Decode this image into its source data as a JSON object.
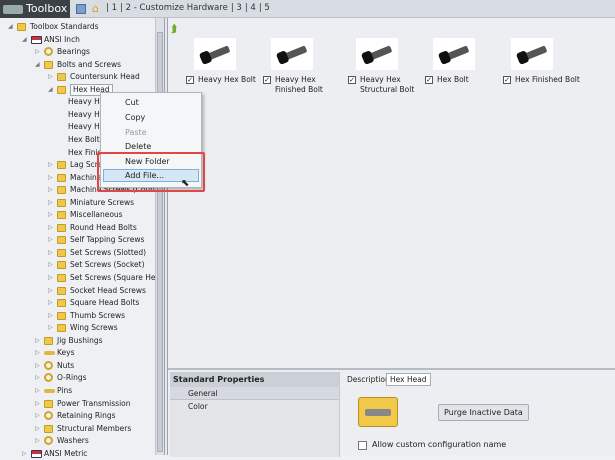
{
  "titlebar": {
    "title": "Toolbox",
    "breadcrumbs": [
      "1",
      "2 - Customize Hardware",
      "3",
      "4",
      "5"
    ]
  },
  "tree": [
    {
      "label": "Toolbox Standards",
      "level": 0,
      "icon": "folder-icon",
      "expanded": true
    },
    {
      "label": "ANSI Inch",
      "level": 1,
      "icon": "flag-icon",
      "expanded": true
    },
    {
      "label": "Bearings",
      "level": 2,
      "icon": "bearing-icon",
      "expanded": false
    },
    {
      "label": "Bolts and Screws",
      "level": 2,
      "icon": "folder-icon",
      "expanded": true
    },
    {
      "label": "Countersunk Head",
      "level": 3,
      "icon": "folder-icon",
      "expanded": false
    },
    {
      "label": "Hex Head",
      "level": 3,
      "icon": "folder-icon",
      "expanded": true,
      "selected": true
    },
    {
      "label": "Heavy He",
      "level": 4
    },
    {
      "label": "Heavy He",
      "level": 4
    },
    {
      "label": "Heavy He",
      "level": 4
    },
    {
      "label": "Hex Bolt",
      "level": 4
    },
    {
      "label": "Hex Finish",
      "level": 4
    },
    {
      "label": "Lag Screws",
      "level": 3,
      "icon": "folder-icon",
      "expanded": false
    },
    {
      "label": "Machine",
      "level": 3,
      "icon": "folder-icon",
      "expanded": false
    },
    {
      "label": "Machine Screws (Countersunk)",
      "level": 3,
      "icon": "folder-icon",
      "expanded": false
    },
    {
      "label": "Miniature Screws",
      "level": 3,
      "icon": "folder-icon",
      "expanded": false
    },
    {
      "label": "Miscellaneous",
      "level": 3,
      "icon": "folder-icon",
      "expanded": false
    },
    {
      "label": "Round Head Bolts",
      "level": 3,
      "icon": "folder-icon",
      "expanded": false
    },
    {
      "label": "Self Tapping Screws",
      "level": 3,
      "icon": "folder-icon",
      "expanded": false
    },
    {
      "label": "Set Screws (Slotted)",
      "level": 3,
      "icon": "folder-icon",
      "expanded": false
    },
    {
      "label": "Set Screws (Socket)",
      "level": 3,
      "icon": "folder-icon",
      "expanded": false
    },
    {
      "label": "Set Screws (Square Head",
      "level": 3,
      "icon": "folder-icon",
      "expanded": false
    },
    {
      "label": "Socket Head Screws",
      "level": 3,
      "icon": "folder-icon",
      "expanded": false
    },
    {
      "label": "Square Head Bolts",
      "level": 3,
      "icon": "folder-icon",
      "expanded": false
    },
    {
      "label": "Thumb Screws",
      "level": 3,
      "icon": "folder-icon",
      "expanded": false
    },
    {
      "label": "Wing Screws",
      "level": 3,
      "icon": "folder-icon",
      "expanded": false
    },
    {
      "label": "Jig Bushings",
      "level": 2,
      "icon": "bushing-icon",
      "expanded": false
    },
    {
      "label": "Keys",
      "level": 2,
      "icon": "key-icon",
      "expanded": false
    },
    {
      "label": "Nuts",
      "level": 2,
      "icon": "nut-icon",
      "expanded": false
    },
    {
      "label": "O-Rings",
      "level": 2,
      "icon": "oring-icon",
      "expanded": false
    },
    {
      "label": "Pins",
      "level": 2,
      "icon": "pin-icon",
      "expanded": false
    },
    {
      "label": "Power Transmission",
      "level": 2,
      "icon": "gear-icon",
      "expanded": false
    },
    {
      "label": "Retaining Rings",
      "level": 2,
      "icon": "retaining-ring-icon",
      "expanded": false
    },
    {
      "label": "Structural Members",
      "level": 2,
      "icon": "beam-icon",
      "expanded": false
    },
    {
      "label": "Washers",
      "level": 2,
      "icon": "washer-icon",
      "expanded": false
    },
    {
      "label": "ANSI Metric",
      "level": 1,
      "icon": "flag-icon",
      "expanded": false
    }
  ],
  "context_menu": {
    "items": [
      {
        "label": "Cut"
      },
      {
        "label": "Copy"
      },
      {
        "label": "Paste",
        "disabled": true
      },
      {
        "label": "Delete"
      },
      {
        "label": "New Folder"
      },
      {
        "label": "Add File...",
        "highlighted": true
      }
    ]
  },
  "parts": [
    {
      "name": "Heavy Hex Bolt",
      "checked": true
    },
    {
      "name": "Heavy Hex Finished Bolt",
      "checked": true
    },
    {
      "name": "Heavy Hex Structural Bolt",
      "checked": true
    },
    {
      "name": "Hex Bolt",
      "checked": true
    },
    {
      "name": "Hex Finished Bolt",
      "checked": true
    }
  ],
  "properties": {
    "header": "Standard Properties",
    "items": [
      "General",
      "Color"
    ],
    "selected": "General"
  },
  "detail": {
    "description_label": "Description",
    "description_value": "Hex Head",
    "purge_button": "Purge Inactive Data",
    "allow_custom_label": "Allow custom configuration name",
    "allow_custom_checked": false
  },
  "colors": {
    "highlight": "#e04848",
    "folder": "#f0c94a"
  }
}
